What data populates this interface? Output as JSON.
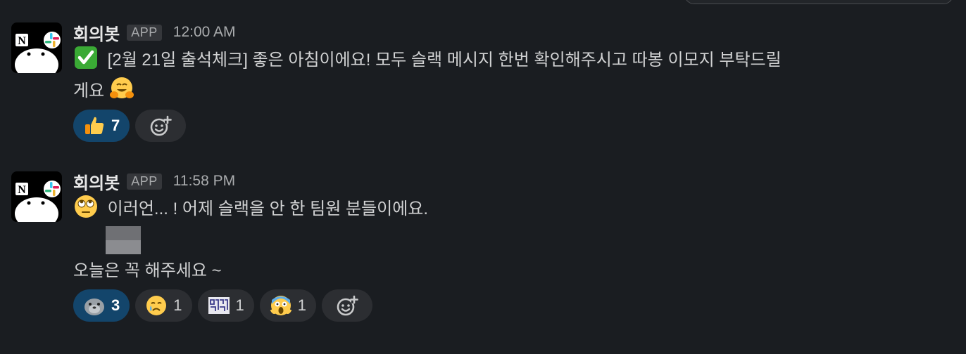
{
  "messages": [
    {
      "sender": "회의봇",
      "badge": "APP",
      "time": "12:00 AM",
      "lines": [
        "[2월 21일 출석체크] 좋은 아침이에요! 모두 슬랙 메시지 한번 확인해주시고 따봉 이모지 부탁드릴",
        "게요"
      ],
      "lead_emoji": "check-mark-icon",
      "trail_emoji": "hugging-face-icon",
      "reactions": [
        {
          "emoji": "thumbs-up-icon",
          "count": "7",
          "active": true
        }
      ]
    },
    {
      "sender": "회의봇",
      "badge": "APP",
      "time": "11:58 PM",
      "lines": [
        "이러언... ! 어제 슬랙을 안 한 팀원 분들이에요.",
        "오늘은 꼭 해주세요 ~"
      ],
      "lead_emoji": "eye-roll-face-icon",
      "reactions": [
        {
          "emoji": "seal-icon",
          "count": "3",
          "active": true
        },
        {
          "emoji": "crying-face-icon",
          "count": "1",
          "active": false
        },
        {
          "emoji": "custom-text-emoji-icon",
          "count": "1",
          "active": false
        },
        {
          "emoji": "screaming-face-icon",
          "count": "1",
          "active": false
        }
      ]
    }
  ],
  "colors": {
    "background": "#1a1d21",
    "active_reaction": "#13456b",
    "reaction": "#2c2e32"
  }
}
